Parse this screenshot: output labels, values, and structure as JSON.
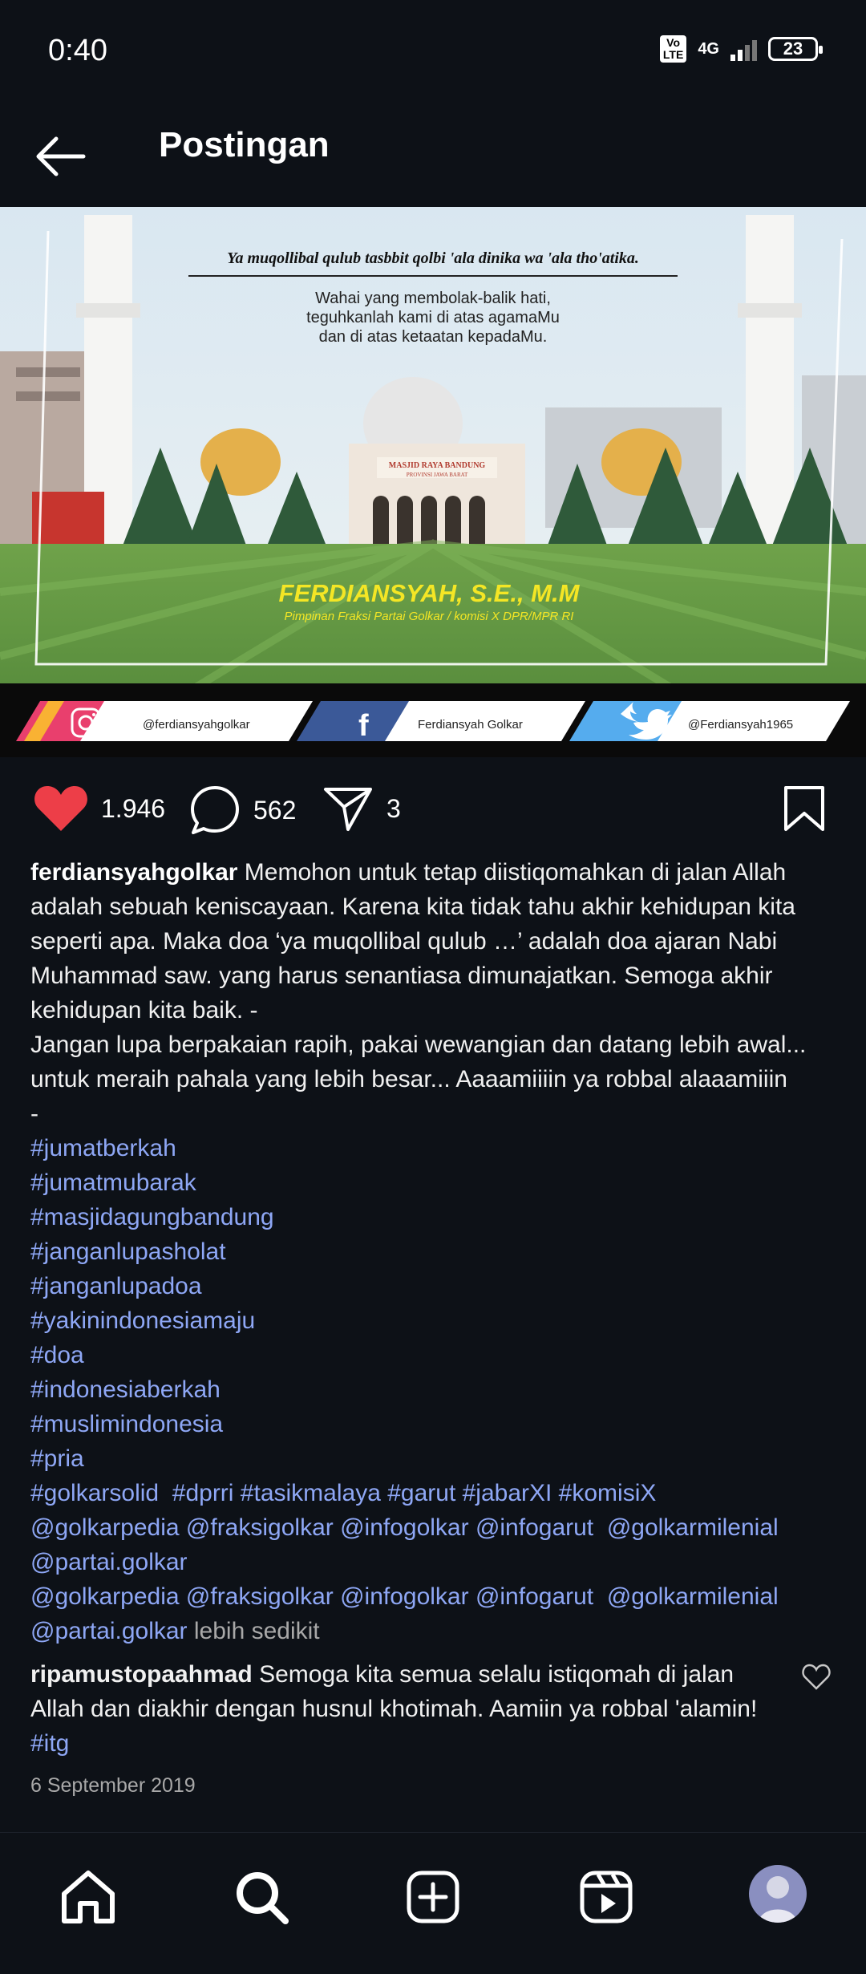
{
  "status": {
    "time": "0:40",
    "volte": "Vo LTE",
    "network": "4G",
    "battery": "23"
  },
  "header": {
    "title": "Postingan"
  },
  "post_image": {
    "transliteration": "Ya muqollibal qulub tasbbit qolbi 'ala dinika wa 'ala tho'atika.",
    "translation_lines": [
      "Wahai yang membolak-balik hati,",
      "teguhkanlah kami di atas agamaMu",
      "dan di atas ketaatan kepadaMu."
    ],
    "mosque_sign_1": "MASJID RAYA BANDUNG",
    "mosque_sign_2": "PROVINSI JAWA BARAT",
    "name": "FERDIANSYAH, S.E., M.M",
    "position": "Pimpinan Fraksi Partai Golkar / komisi X DPR/MPR RI",
    "social": [
      {
        "label": "@ferdiansyahgolkar",
        "icon": "instagram-icon"
      },
      {
        "label": "Ferdiansyah Golkar",
        "icon": "facebook-icon"
      },
      {
        "label": "@Ferdiansyah1965",
        "icon": "twitter-icon"
      }
    ]
  },
  "actions": {
    "likes": "1.946",
    "comments": "562",
    "shares": "3"
  },
  "caption": {
    "username": "ferdiansyahgolkar",
    "text": "Memohon untuk tetap diistiqomahkan di jalan Allah adalah sebuah keniscayaan. Karena kita tidak tahu akhir kehidupan kita seperti apa. Maka doa ‘ya muqollibal qulub …’ adalah doa ajaran Nabi Muhammad saw. yang harus senantiasa dimunajatkan. Semoga akhir kehidupan kita baik. -",
    "text2": "Jangan lupa berpakaian rapih, pakai wewangian dan datang lebih awal... untuk meraih pahala yang lebih besar... Aaaamiiiin ya robbal alaaamiiin",
    "dash": "-",
    "hashtags": [
      "#jumatberkah",
      "#jumatmubarak",
      "#masjidagungbandung",
      "#janganlupasholat",
      "#janganlupadoa",
      "#yakinindonesiamaju",
      "#doa",
      "#indonesiaberkah",
      "#muslimindonesia",
      "#pria"
    ],
    "tags_line": "#golkarsolid  #dprri #tasikmalaya #garut #jabarXI #komisiX",
    "mentions_1": "@golkarpedia @fraksigolkar @infogolkar @infogarut  @golkarmilenial",
    "mentions_1b": "@partai.golkar",
    "mentions_2": "@golkarpedia @fraksigolkar @infogolkar @infogarut  @golkarmilenial",
    "mentions_2b": "@partai.golkar",
    "more": "lebih sedikit"
  },
  "comment": {
    "username": "ripamustopaahmad",
    "text": "Semoga kita semua selalu istiqomah di jalan Allah dan diakhir dengan husnul khotimah. Aamiin ya robbal 'alamin!",
    "tag": "#itg"
  },
  "date": "6 September 2019",
  "nav": [
    "home-icon",
    "search-icon",
    "add-post-icon",
    "reels-icon",
    "profile-avatar"
  ]
}
